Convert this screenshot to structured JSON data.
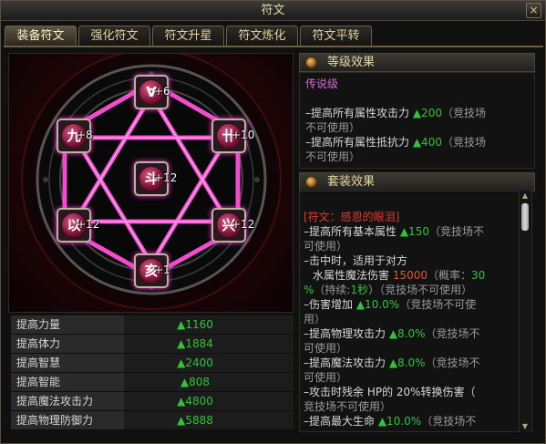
{
  "window": {
    "title": "符文",
    "close_label": "×"
  },
  "tabs": [
    {
      "label": "装备符文"
    },
    {
      "label": "强化符文"
    },
    {
      "label": "符文升星"
    },
    {
      "label": "符文炼化"
    },
    {
      "label": "符文平转"
    }
  ],
  "runes": [
    {
      "glyph": "Ɐ",
      "level": "+6"
    },
    {
      "glyph": "九",
      "level": "+8"
    },
    {
      "glyph": "卄",
      "level": "+10"
    },
    {
      "glyph": "斗",
      "level": "+12"
    },
    {
      "glyph": "以",
      "level": "+12"
    },
    {
      "glyph": "兴",
      "level": "+12"
    },
    {
      "glyph": "亥",
      "level": "+1"
    }
  ],
  "stats": [
    {
      "name": "提高力量",
      "value": "▲1160"
    },
    {
      "name": "提高体力",
      "value": "▲1884"
    },
    {
      "name": "提高智慧",
      "value": "▲2400"
    },
    {
      "name": "提高智能",
      "value": "▲808"
    },
    {
      "name": "提高魔法攻击力",
      "value": "▲4800"
    },
    {
      "name": "提高物理防御力",
      "value": "▲5888"
    }
  ],
  "level_effect": {
    "header": "等级效果",
    "grade": "传说级",
    "l1a": "–提高所有属性攻击力 ",
    "l1b": "▲200",
    "l1c": "（竞技场",
    "l1d": "不可使用）",
    "l2a": "–提高所有属性抵抗力 ",
    "l2b": "▲400",
    "l2c": "（竞技场",
    "l2d": "不可使用）"
  },
  "set_effect": {
    "header": "套装效果",
    "set_name": "[符文：感恩的眼泪]",
    "s1a": "–提高所有基本属性 ",
    "s1b": "▲150",
    "s1c": "（竞技场不",
    "s1d": "可使用）",
    "s2": "–击中时，适用于对方",
    "s3a": "水属性魔法伤害 ",
    "s3b": "15000",
    "s3c": "（概率：",
    "s3d": "30",
    "s4a": "%",
    "s4b": "（持续:",
    "s4c": "1秒",
    "s4d": "）（竞技场不可使用）",
    "s5a": "–伤害增加 ",
    "s5b": "▲10.0%",
    "s5c": "（竞技场不可使",
    "s5d": "用）",
    "s6a": "–提高物理攻击力 ",
    "s6b": "▲8.0%",
    "s6c": "（竞技场不",
    "s6d": "可使用）",
    "s7a": "–提高魔法攻击力 ",
    "s7b": "▲8.0%",
    "s7c": "（竞技场不",
    "s7d": "可使用）",
    "s8": "–攻击时残余 HP的 20%转换伤害（",
    "s9": "竞技场不可使用）",
    "s10a": "–提高最大生命 ",
    "s10b": "▲10.0%",
    "s10c": "（竞技场不"
  },
  "colors": {
    "accent_pink": "#ff3cd0",
    "stat_green": "#33c23a",
    "gold_text": "#e7d6a3"
  }
}
